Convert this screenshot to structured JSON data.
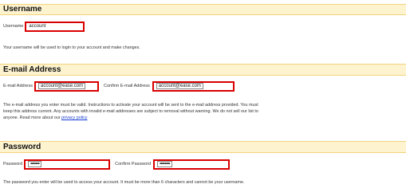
{
  "username": {
    "header": "Username",
    "label": "Username",
    "value": "account",
    "help": "Your username will be used to login to your account and make changes."
  },
  "email": {
    "header": "E-mail Address",
    "label": "E-mail Address",
    "value": "account@ease.com",
    "confirm_label": "Confirm E-mail Address",
    "confirm_value": "account@ease.com",
    "help_line1": "The e-mail address you enter must be valid. Instructions to activate your account will be sent to the e-mail address provided. You must",
    "help_line2": "keep this address current. Any accounts with invalid e-mail addresses are subject to removal without warning. We do not sell our list to",
    "help_line3_prefix": "anyone. Read more about our ",
    "privacy_link": "privacy policy"
  },
  "password": {
    "header": "Password",
    "label": "Password",
    "value": "•••••••",
    "confirm_label": "Confirm Password",
    "confirm_value": "••••••••",
    "help": "The password you enter will be used to access your account. It must be more than 6 characters and cannot be your username."
  },
  "colors": {
    "header_bg": "#fdf3cf",
    "header_border": "#f2d37a",
    "highlight": "#d90000",
    "link": "#1a3fd1"
  }
}
